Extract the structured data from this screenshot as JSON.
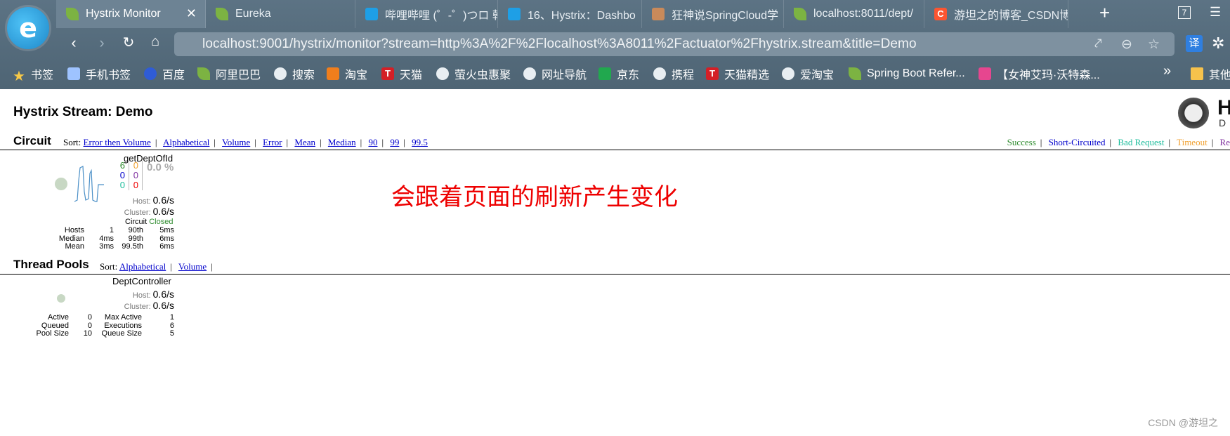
{
  "browser": {
    "logo_glyph": "e",
    "tabs": [
      {
        "title": "Hystrix Monitor",
        "icon": "spring-leaf-icon"
      },
      {
        "title": "Eureka",
        "icon": "spring-leaf-icon"
      },
      {
        "title": "哔哩哔哩 (゜-゜)つロ 乾",
        "icon": "bilibili-tv-icon"
      },
      {
        "title": "16、Hystrix：Dashbo",
        "icon": "bilibili-tv-icon"
      },
      {
        "title": "狂神说SpringCloud学",
        "icon": "avatar-icon"
      },
      {
        "title": "localhost:8011/dept/",
        "icon": "spring-leaf-icon"
      },
      {
        "title": "游坦之的博客_CSDN博",
        "icon": "csdn-icon"
      }
    ],
    "csdn_letter": "C",
    "new_tab": "+",
    "close_tab": "✕",
    "tab_count": "7",
    "url": "localhost:9001/hystrix/monitor?stream=http%3A%2F%2Flocalhost%3A8011%2Factuator%2Fhystrix.stream&title=Demo",
    "translate_badge": "译",
    "bookmarks": [
      "书签",
      "手机书签",
      "百度",
      "阿里巴巴",
      "搜索",
      "淘宝",
      "天猫",
      "萤火虫惠聚",
      "网址导航",
      "京东",
      "携程",
      "天猫精选",
      "爱淘宝",
      "Spring Boot Refer...",
      "【女神艾玛·沃特森...",
      "其他"
    ],
    "more_bookmarks": "»",
    "tmall_letter": "T",
    "taobao_letter": "淘"
  },
  "page": {
    "title": "Hystrix Stream: Demo",
    "logo_text": "H",
    "logo_sub": "D",
    "circuit_section": {
      "title": "Circuit",
      "sort_label": "Sort:",
      "sort_links": [
        "Error then Volume",
        "Alphabetical",
        "Volume",
        "Error",
        "Mean",
        "Median",
        "90",
        "99",
        "99.5"
      ],
      "legend": [
        {
          "label": "Success",
          "color": "#2e8b2e"
        },
        {
          "label": "Short-Circuited",
          "color": "#0000cc"
        },
        {
          "label": "Bad Request",
          "color": "#1bbc9b"
        },
        {
          "label": "Timeout",
          "color": "#f0a030"
        },
        {
          "label": "Re",
          "color": "#7f2f9f"
        }
      ]
    },
    "circuit": {
      "name": "getDeptOfId",
      "counts_left": [
        {
          "v": "6",
          "color": "#2e8b2e"
        },
        {
          "v": "0",
          "color": "#0000cc"
        },
        {
          "v": "0",
          "color": "#1bbc9b"
        }
      ],
      "counts_right": [
        {
          "v": "0",
          "color": "#f0a030"
        },
        {
          "v": "0",
          "color": "#7f2f9f"
        },
        {
          "v": "0",
          "color": "#e00"
        }
      ],
      "error_pct": "0.0 %",
      "host_label": "Host:",
      "host_rate": "0.6/s",
      "cluster_label": "Cluster:",
      "cluster_rate": "0.6/s",
      "circuit_label": "Circuit",
      "circuit_state": "Closed",
      "stats": {
        "col1_labels": [
          "Hosts",
          "Median",
          "Mean"
        ],
        "col1_values": [
          "1",
          "4ms",
          "3ms"
        ],
        "col2_labels": [
          "90th",
          "99th",
          "99.5th"
        ],
        "col2_values": [
          "5ms",
          "6ms",
          "6ms"
        ]
      }
    },
    "thread_section": {
      "title": "Thread Pools",
      "sort_label": "Sort:",
      "sort_links": [
        "Alphabetical",
        "Volume"
      ]
    },
    "pool": {
      "name": "DeptController",
      "host_label": "Host:",
      "host_rate": "0.6/s",
      "cluster_label": "Cluster:",
      "cluster_rate": "0.6/s",
      "stats": {
        "col1_labels": [
          "Active",
          "Queued",
          "Pool Size"
        ],
        "col1_values": [
          "0",
          "0",
          "10"
        ],
        "col2_labels": [
          "Max Active",
          "Executions",
          "Queue Size"
        ],
        "col2_values": [
          "1",
          "6",
          "5"
        ]
      }
    },
    "note": "会跟着页面的刷新产生变化",
    "watermark": "CSDN @游坦之"
  }
}
